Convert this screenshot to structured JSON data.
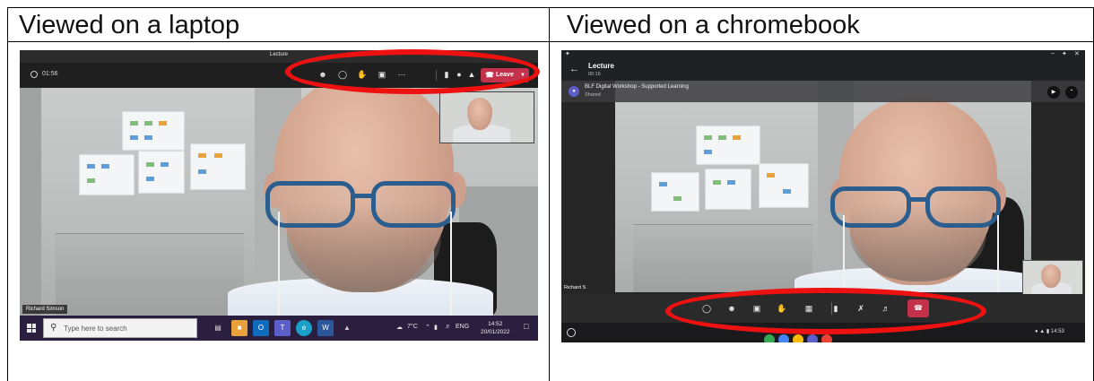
{
  "document": {
    "left_heading": "Viewed on a laptop",
    "right_heading": "Viewed on a chromebook"
  },
  "laptop": {
    "window_title": "Lecture",
    "timer": "01:56",
    "leave_label": "Leave",
    "participant_name": "Richard Simson",
    "taskbar": {
      "search_placeholder": "Type here to search",
      "temperature": "7°C",
      "language": "ENG",
      "time": "14:52",
      "date": "20/01/2022"
    }
  },
  "chromebook": {
    "meeting_title": "Lecture",
    "timer": "00:16",
    "banner_title": "BLF Digital Workshop - Supported Learning",
    "banner_sub": "Shared",
    "participant_name": "Richard S",
    "status_time": "14:53"
  },
  "colors": {
    "annotation_red": "#ee1111",
    "leave_red": "#c4314b",
    "teams_purple": "#5b5fc7",
    "glasses_blue": "#2b5e8f"
  }
}
